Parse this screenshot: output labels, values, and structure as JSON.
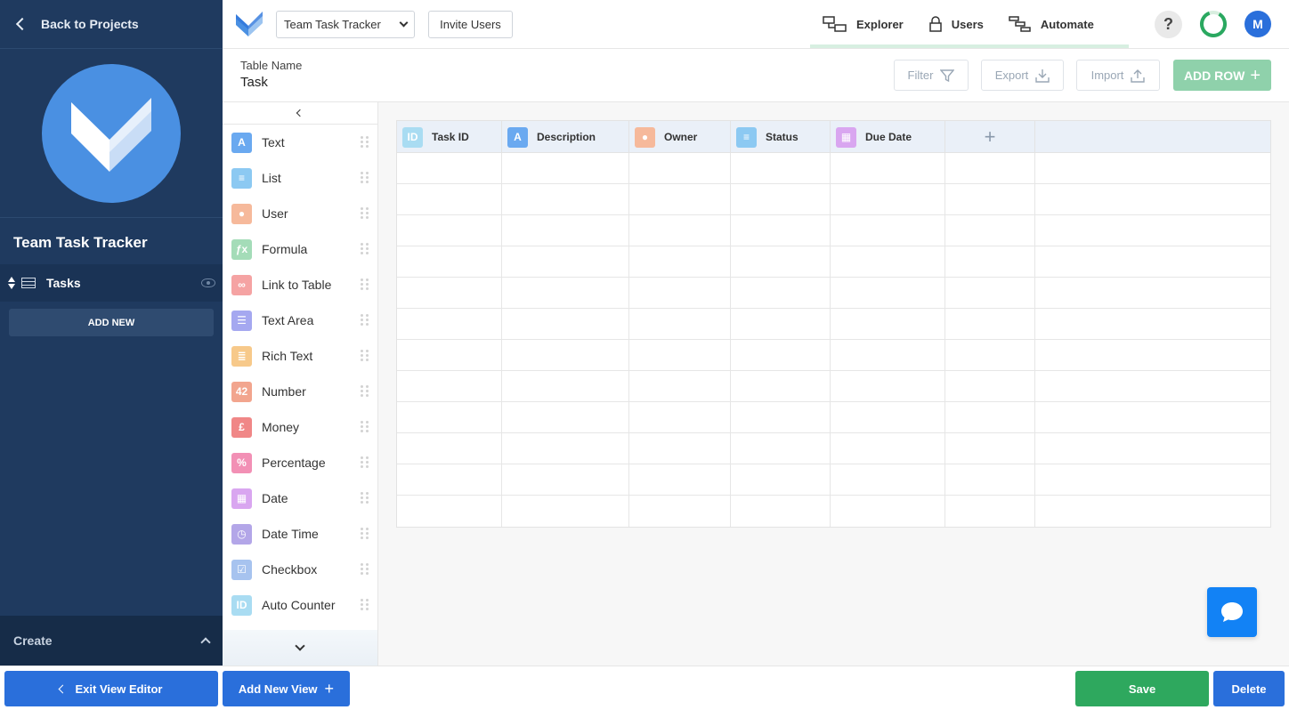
{
  "sidebar": {
    "back_label": "Back to Projects",
    "project_name": "Team Task Tracker",
    "table_name": "Tasks",
    "add_new_label": "ADD NEW",
    "create_label": "Create"
  },
  "topbar": {
    "project_select_value": "Team Task Tracker",
    "invite_label": "Invite Users",
    "nav": [
      {
        "label": "Explorer",
        "icon": "explorer-icon"
      },
      {
        "label": "Users",
        "icon": "lock-icon"
      },
      {
        "label": "Automate",
        "icon": "automate-icon"
      }
    ],
    "help_label": "?",
    "avatar_initial": "M",
    "progress_color": "#2aa860"
  },
  "header": {
    "table_name_label": "Table Name",
    "table_name_value": "Task",
    "filter_label": "Filter",
    "export_label": "Export",
    "import_label": "Import",
    "add_row_label": "ADD ROW",
    "add_row_plus": "+"
  },
  "palette": {
    "items": [
      {
        "label": "Text",
        "glyph": "A",
        "color": "#6aa9f0",
        "icon": "text-field-icon"
      },
      {
        "label": "List",
        "glyph": "≡",
        "color": "#8cc9f2",
        "icon": "list-field-icon"
      },
      {
        "label": "User",
        "glyph": "●",
        "color": "#f6b99b",
        "icon": "user-field-icon"
      },
      {
        "label": "Formula",
        "glyph": "ƒx",
        "color": "#a4dcb8",
        "icon": "formula-field-icon"
      },
      {
        "label": "Link to Table",
        "glyph": "∞",
        "color": "#f5a3a3",
        "icon": "link-field-icon"
      },
      {
        "label": "Text Area",
        "glyph": "☰",
        "color": "#a5a8f0",
        "icon": "textarea-field-icon"
      },
      {
        "label": "Rich Text",
        "glyph": "≣",
        "color": "#f7c98a",
        "icon": "richtext-field-icon"
      },
      {
        "label": "Number",
        "glyph": "42",
        "color": "#f2a58e",
        "icon": "number-field-icon"
      },
      {
        "label": "Money",
        "glyph": "£",
        "color": "#f08787",
        "icon": "money-field-icon"
      },
      {
        "label": "Percentage",
        "glyph": "%",
        "color": "#f290b5",
        "icon": "percentage-field-icon"
      },
      {
        "label": "Date",
        "glyph": "▦",
        "color": "#d9a6f0",
        "icon": "date-field-icon"
      },
      {
        "label": "Date Time",
        "glyph": "◷",
        "color": "#b3a6e8",
        "icon": "datetime-field-icon"
      },
      {
        "label": "Checkbox",
        "glyph": "☑",
        "color": "#a7c3ef",
        "icon": "checkbox-field-icon"
      },
      {
        "label": "Auto Counter",
        "glyph": "ID",
        "color": "#a9dcf2",
        "icon": "autocounter-field-icon"
      }
    ]
  },
  "grid": {
    "columns": [
      {
        "label": "Task ID",
        "glyph": "ID",
        "color": "#a9dcf2",
        "icon": "autocounter-field-icon"
      },
      {
        "label": "Description",
        "glyph": "A",
        "color": "#6aa9f0",
        "icon": "text-field-icon"
      },
      {
        "label": "Owner",
        "glyph": "●",
        "color": "#f6b99b",
        "icon": "user-field-icon"
      },
      {
        "label": "Status",
        "glyph": "≡",
        "color": "#8cc9f2",
        "icon": "list-field-icon"
      },
      {
        "label": "Due Date",
        "glyph": "▦",
        "color": "#d9a6f0",
        "icon": "date-field-icon"
      }
    ],
    "add_column_label": "+"
  },
  "footer": {
    "exit_label": "Exit View Editor",
    "add_view_label": "Add New View",
    "add_view_plus": "+",
    "save_label": "Save",
    "delete_label": "Delete",
    "colors": {
      "primary": "#2a6fdb",
      "save": "#2ea85e"
    }
  }
}
